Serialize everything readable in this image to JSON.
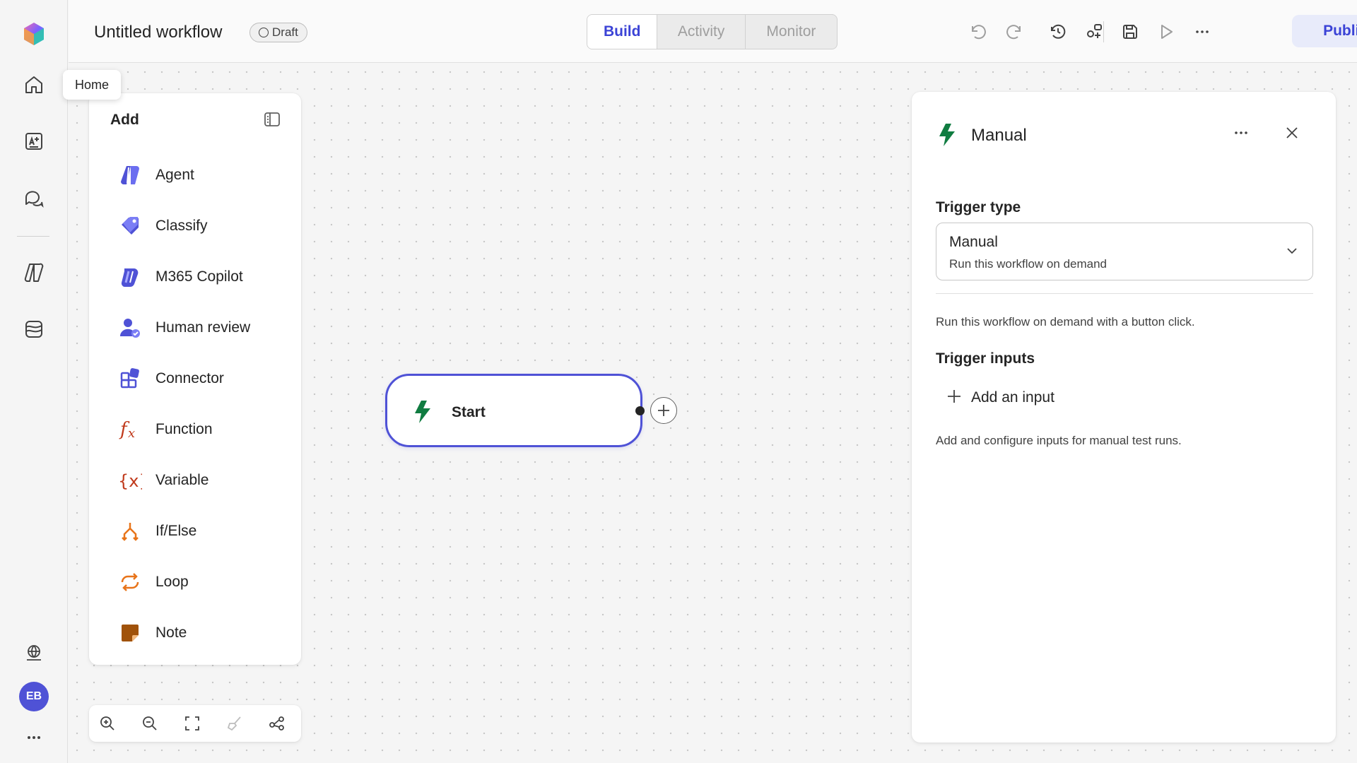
{
  "header": {
    "workflow_title": "Untitled workflow",
    "status_badge": "Draft",
    "tabs": [
      {
        "label": "Build",
        "active": true
      },
      {
        "label": "Activity",
        "active": false
      },
      {
        "label": "Monitor",
        "active": false
      }
    ],
    "toolbar_icons": [
      "undo-icon",
      "redo-icon",
      "history-icon",
      "share-icon",
      "save-icon",
      "run-icon",
      "more-icon"
    ],
    "publish_label": "Publish"
  },
  "rail": {
    "items": [
      "home-icon",
      "create-icon",
      "chat-icon",
      "agents-icon",
      "library-icon"
    ],
    "bottom_items": [
      "globe-icon",
      "more-icon"
    ],
    "avatar_initials": "EB",
    "tooltip": "Home"
  },
  "add_panel": {
    "title": "Add",
    "items": [
      {
        "label": "Agent",
        "icon": "agent-icon"
      },
      {
        "label": "Classify",
        "icon": "classify-icon"
      },
      {
        "label": "M365 Copilot",
        "icon": "copilot-icon"
      },
      {
        "label": "Human review",
        "icon": "human-review-icon"
      },
      {
        "label": "Connector",
        "icon": "connector-icon"
      },
      {
        "label": "Function",
        "icon": "function-icon"
      },
      {
        "label": "Variable",
        "icon": "variable-icon"
      },
      {
        "label": "If/Else",
        "icon": "branch-icon"
      },
      {
        "label": "Loop",
        "icon": "loop-icon"
      },
      {
        "label": "Note",
        "icon": "note-icon"
      }
    ]
  },
  "zoom_toolbar": [
    "zoom-in-icon",
    "zoom-out-icon",
    "fit-view-icon",
    "clean-up-icon",
    "layout-icon"
  ],
  "canvas": {
    "start_node_label": "Start"
  },
  "trigger_panel": {
    "title": "Manual",
    "trigger_type_label": "Trigger type",
    "trigger_select_value": "Manual",
    "trigger_select_desc": "Run this workflow on demand",
    "description": "Run this workflow on demand with a button click.",
    "inputs_label": "Trigger inputs",
    "add_input_label": "Add an input",
    "inputs_help": "Add and configure inputs for manual test runs."
  },
  "colors": {
    "accent": "#3b43d6",
    "trigger_green": "#107c41",
    "publish_bg": "#e8ebfa"
  }
}
